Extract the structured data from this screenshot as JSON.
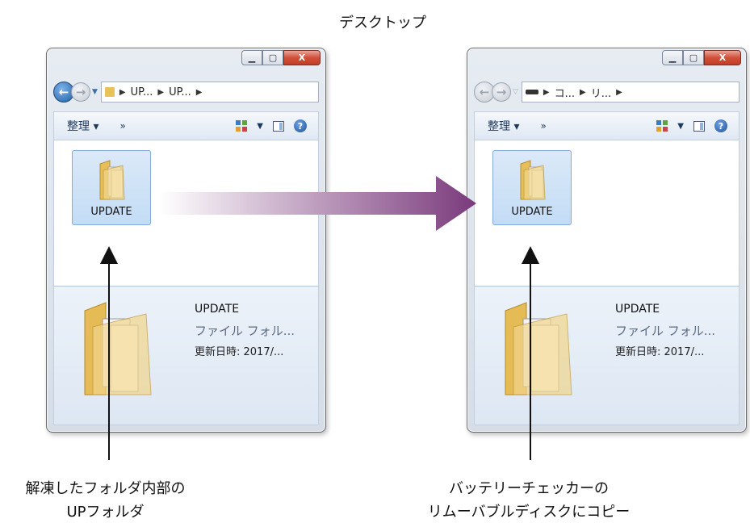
{
  "top_caption": "デスクトップ",
  "windows": {
    "left": {
      "breadcrumb": [
        "UP...",
        "UP..."
      ],
      "toolbar": {
        "organize": "整理 ▾",
        "more": "»"
      },
      "item_label": "UPDATE",
      "details": {
        "name": "UPDATE",
        "type": "ファイル フォル...",
        "modified": "更新日時: 2017/..."
      }
    },
    "right": {
      "breadcrumb": [
        "コ...",
        "リ..."
      ],
      "toolbar": {
        "organize": "整理 ▾",
        "more": "»"
      },
      "item_label": "UPDATE",
      "details": {
        "name": "UPDATE",
        "type": "ファイル フォル...",
        "modified": "更新日時: 2017/..."
      }
    }
  },
  "captions": {
    "left": [
      "解凍したフォルダ内部の",
      "UPフォルダ"
    ],
    "right": [
      "バッテリーチェッカーの",
      "リムーバブルディスクにコピー"
    ]
  },
  "colors": {
    "arrow_start": "#ffffff",
    "arrow_end": "#7a3a7c",
    "pointer": "#111111"
  }
}
